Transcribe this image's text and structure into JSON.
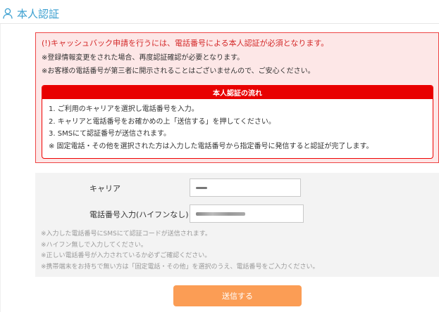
{
  "page": {
    "title": "本人認証"
  },
  "notice": {
    "line1": "(!)キャッシュバック申請を行うには、電話番号による本人認証が必須となります。",
    "line2": "※登録情報変更をされた場合、再度認証確認が必要となります。",
    "line3": "※お客様の電話番号が第三者に開示されることはございませんので、ご安心ください。"
  },
  "flow": {
    "heading": "本人認証の流れ",
    "steps": [
      "1. ご利用のキャリアを選択し電話番号を入力。",
      "2. キャリアと電話番号をお確かめの上「送信する」を押してください。",
      "3. SMSにて認証番号が送信されます。",
      "※ 固定電話・その他を選択された方は入力した電話番号から指定番号に発信すると認証が完了します。"
    ]
  },
  "form": {
    "carrier_label": "キャリア",
    "phone_label": "電話番号入力(ハイフンなし)",
    "notes": [
      "※入力した電話番号にSMSにて認証コードが送信されます。",
      "※ハイフン無しで入力してください。",
      "※正しい電話番号が入力されているか必ずご確認ください。",
      "※携帯端末をお持ちで無い方は「固定電話・その他」を選択のうえ、電話番号をご入力ください。"
    ]
  },
  "submit_label": "送信する",
  "colors": {
    "title": "#3a9fd0",
    "alert": "#e80000",
    "button": "#fb9d55"
  }
}
